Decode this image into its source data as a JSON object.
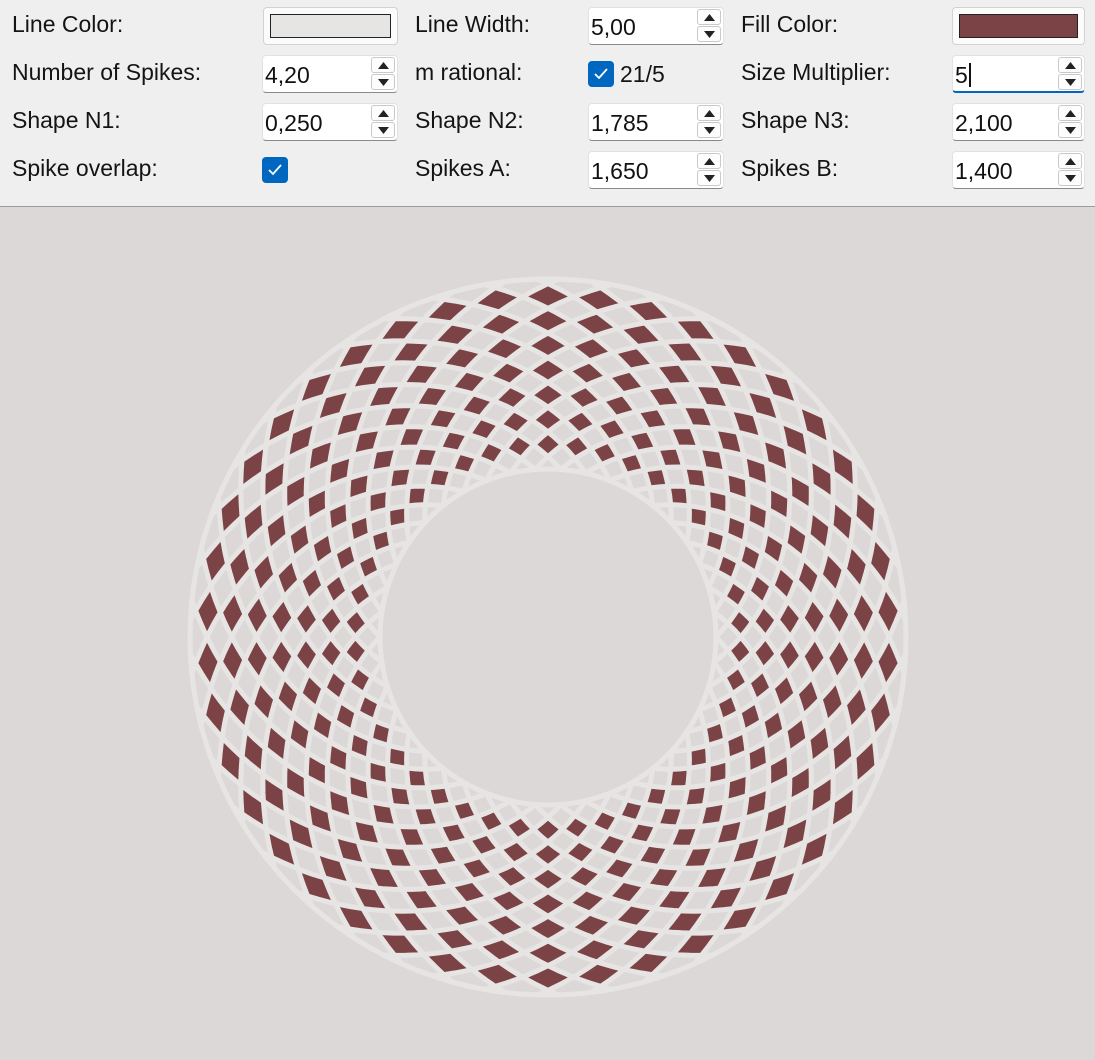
{
  "controls": {
    "line_color": {
      "label": "Line Color:",
      "value": "#e7e5e3"
    },
    "line_width": {
      "label": "Line Width:",
      "value": "5,00"
    },
    "fill_color": {
      "label": "Fill Color:",
      "value": "#7b4345"
    },
    "num_spikes": {
      "label": "Number of Spikes:",
      "value": "4,20"
    },
    "m_rational": {
      "label": "m rational:",
      "checked": true,
      "value": "21/5"
    },
    "size_multiplier": {
      "label": "Size Multiplier:",
      "value": "5"
    },
    "shape_n1": {
      "label": "Shape N1:",
      "value": "0,250"
    },
    "shape_n2": {
      "label": "Shape N2:",
      "value": "1,785"
    },
    "shape_n3": {
      "label": "Shape N3:",
      "value": "2,100"
    },
    "spike_overlap": {
      "label": "Spike overlap:",
      "checked": true
    },
    "spikes_a": {
      "label": "Spikes A:",
      "value": "1,650"
    },
    "spikes_b": {
      "label": "Spikes B:",
      "value": "1,400"
    }
  },
  "canvas": {
    "background": "#dcd8d8",
    "spoke_count": 21,
    "twist_direction_1": "clockwise",
    "twist_direction_2": "counter-clockwise"
  }
}
